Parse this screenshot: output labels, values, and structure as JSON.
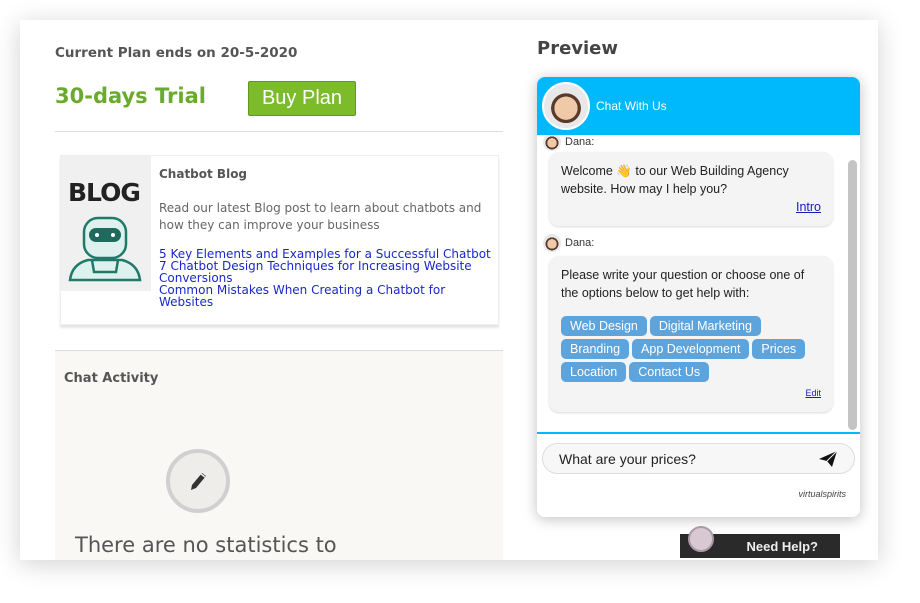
{
  "plan": {
    "ends_text": "Current Plan ends on 20-5-2020",
    "trial_label": "30-days Trial",
    "buy_label": "Buy Plan",
    "accent": "#6aab2e"
  },
  "blog": {
    "image_text": "BLOG",
    "title": "Chatbot Blog",
    "description": "Read our latest Blog post to learn about chatbots and how they can improve your business",
    "links": [
      "5 Key Elements and Examples for a Successful Chatbot",
      "7 Chatbot Design Techniques for Increasing Website Conversions",
      "Common Mistakes When Creating a Chatbot for Websites"
    ]
  },
  "activity": {
    "title": "Chat Activity",
    "empty_text": "There are no statistics to",
    "icon": "pencil-icon"
  },
  "preview": {
    "heading": "Preview",
    "chat": {
      "title": "Chat With Us",
      "header_color": "#00b9fc",
      "messages": [
        {
          "sender": "Dana:",
          "text": "Welcome 👋 to our Web Building Agency website. How may I help you?",
          "link": "Intro"
        },
        {
          "sender": "Dana:",
          "text": "Please write your question or choose one of the options below to get help with:",
          "options": [
            "Web Design",
            "Digital Marketing",
            "Branding",
            "App Development",
            "Prices",
            "Location",
            "Contact Us"
          ],
          "link": "Edit"
        }
      ],
      "input_value": "What are your prices?",
      "brand": "virtualspirits"
    }
  },
  "help_button": "Need Help?"
}
